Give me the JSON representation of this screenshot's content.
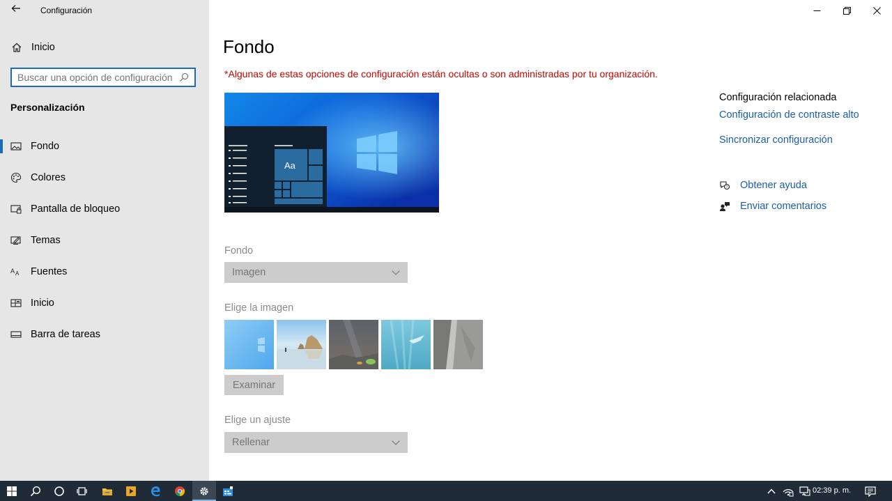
{
  "window": {
    "title": "Configuración",
    "controls": [
      "minimize-icon",
      "restore-icon",
      "close-icon"
    ]
  },
  "sidebar": {
    "home_label": "Inicio",
    "search_placeholder": "Buscar una opción de configuración",
    "section_title": "Personalización",
    "items": [
      {
        "label": "Fondo",
        "icon": "picture-icon",
        "active": true
      },
      {
        "label": "Colores",
        "icon": "palette-icon",
        "active": false
      },
      {
        "label": "Pantalla de bloqueo",
        "icon": "lock-screen-icon",
        "active": false
      },
      {
        "label": "Temas",
        "icon": "themes-icon",
        "active": false
      },
      {
        "label": "Fuentes",
        "icon": "fonts-icon",
        "active": false
      },
      {
        "label": "Inicio",
        "icon": "start-layout-icon",
        "active": false
      },
      {
        "label": "Barra de tareas",
        "icon": "taskbar-icon",
        "active": false
      }
    ]
  },
  "main": {
    "title": "Fondo",
    "warning": "*Algunas de estas opciones de configuración están ocultas o son administradas por tu organización.",
    "preview_sample_text": "Aa",
    "background_label": "Fondo",
    "background_value": "Imagen",
    "choose_image_label": "Elige la imagen",
    "browse_label": "Examinar",
    "fit_label": "Elige un ajuste",
    "fit_value": "Rellenar"
  },
  "related": {
    "heading": "Configuración relacionada",
    "links": [
      "Configuración de contraste alto",
      "Sincronizar configuración"
    ],
    "help_label": "Obtener ayuda",
    "feedback_label": "Enviar comentarios"
  },
  "taskbar": {
    "clock": "02:39 p. m.",
    "items": [
      "windows-start-icon",
      "search-icon",
      "cortana-icon",
      "task-view-icon",
      "file-explorer-icon",
      "media-player-icon",
      "edge-icon",
      "chrome-icon",
      "settings-icon",
      "app-icon"
    ]
  },
  "colors": {
    "accent": "#1d6bb5",
    "warning": "#c50500",
    "link": "#1a5fa8",
    "sidebar_bg": "#e6e6e6",
    "taskbar_bg": "#1f2c38"
  }
}
